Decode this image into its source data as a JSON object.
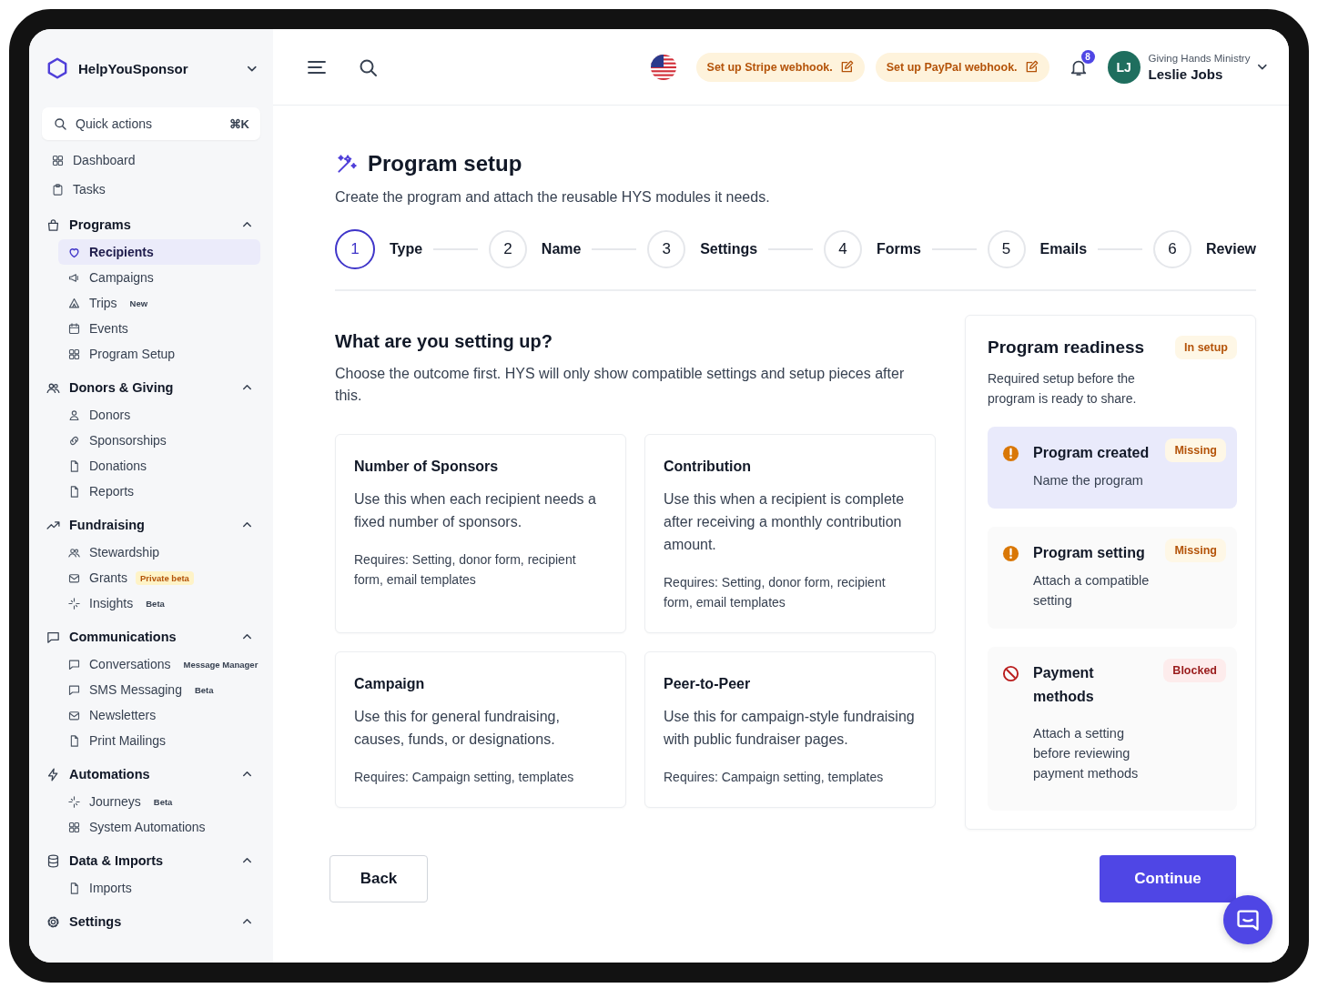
{
  "brand": {
    "name": "HelpYouSponsor"
  },
  "quick_actions": {
    "placeholder": "Quick actions",
    "shortcut": "⌘K"
  },
  "nav_top": [
    {
      "label": "Dashboard",
      "selected": false
    },
    {
      "label": "Tasks",
      "selected": false
    }
  ],
  "sections": [
    {
      "label": "Programs",
      "expanded": true,
      "items": [
        {
          "label": "Recipients",
          "selected": true
        },
        {
          "label": "Campaigns",
          "selected": false
        },
        {
          "label": "Trips",
          "selected": false,
          "badge": {
            "text": "New",
            "kind": "plain"
          }
        },
        {
          "label": "Events",
          "selected": false
        },
        {
          "label": "Program Setup",
          "selected": false
        }
      ]
    },
    {
      "label": "Donors & Giving",
      "expanded": true,
      "items": [
        {
          "label": "Donors",
          "selected": false
        },
        {
          "label": "Sponsorships",
          "selected": false
        },
        {
          "label": "Donations",
          "selected": false
        },
        {
          "label": "Reports",
          "selected": false
        }
      ]
    },
    {
      "label": "Fundraising",
      "expanded": true,
      "items": [
        {
          "label": "Stewardship",
          "selected": false
        },
        {
          "label": "Grants",
          "selected": false,
          "badge": {
            "text": "Private beta",
            "kind": "highlight"
          }
        },
        {
          "label": "Insights",
          "selected": false,
          "badge": {
            "text": "Beta",
            "kind": "plain"
          }
        }
      ]
    },
    {
      "label": "Communications",
      "expanded": true,
      "items": [
        {
          "label": "Conversations",
          "selected": false,
          "badge": {
            "text": "Message Manager",
            "kind": "plain"
          }
        },
        {
          "label": "SMS Messaging",
          "selected": false,
          "badge": {
            "text": "Beta",
            "kind": "plain"
          }
        },
        {
          "label": "Newsletters",
          "selected": false
        },
        {
          "label": "Print Mailings",
          "selected": false
        }
      ]
    },
    {
      "label": "Automations",
      "expanded": true,
      "items": [
        {
          "label": "Journeys",
          "selected": false,
          "badge": {
            "text": "Beta",
            "kind": "plain"
          }
        },
        {
          "label": "System Automations",
          "selected": false
        }
      ]
    },
    {
      "label": "Data & Imports",
      "expanded": true,
      "items": [
        {
          "label": "Imports",
          "selected": false
        }
      ]
    },
    {
      "label": "Settings",
      "expanded": true
    }
  ],
  "header": {
    "webhooks": [
      "Set up Stripe webhook.",
      "Set up PayPal webhook."
    ],
    "notifications": "8",
    "user": {
      "initials": "LJ",
      "organization": "Giving Hands Ministry",
      "name": "Leslie Jobs"
    }
  },
  "page": {
    "title": "Program setup",
    "subtitle": "Create the program and attach the reusable HYS modules it needs."
  },
  "steps": [
    {
      "number": "1",
      "label": "Type",
      "selected": true
    },
    {
      "number": "2",
      "label": "Name",
      "selected": false
    },
    {
      "number": "3",
      "label": "Settings",
      "selected": false
    },
    {
      "number": "4",
      "label": "Forms",
      "selected": false
    },
    {
      "number": "5",
      "label": "Emails",
      "selected": false
    },
    {
      "number": "6",
      "label": "Review",
      "selected": false
    }
  ],
  "question": {
    "heading": "What are you setting up?",
    "description": "Choose the outcome first. HYS will only show compatible settings and setup pieces after this."
  },
  "options": [
    {
      "title": "Number of Sponsors",
      "description": "Use this when each recipient needs a fixed number of sponsors.",
      "requires": "Requires: Setting, donor form, recipient form, email templates"
    },
    {
      "title": "Contribution",
      "description": "Use this when a recipient is complete after receiving a monthly contribution amount.",
      "requires": "Requires: Setting, donor form, recipient form, email templates"
    },
    {
      "title": "Campaign",
      "description": "Use this for general fundraising, causes, funds, or designations.",
      "requires": "Requires: Campaign setting, templates"
    },
    {
      "title": "Peer-to-Peer",
      "description": "Use this for campaign-style fundraising with public fundraiser pages.",
      "requires": "Requires: Campaign setting, templates"
    }
  ],
  "readiness": {
    "title": "Program readiness",
    "status": "In setup",
    "description": "Required setup before the program is ready to share.",
    "items": [
      {
        "title": "Program created",
        "detail": "Name the program",
        "status": "Missing",
        "kind": "missing",
        "selected": true
      },
      {
        "title": "Program setting",
        "detail": "Attach a compatible setting",
        "status": "Missing",
        "kind": "missing",
        "selected": false
      },
      {
        "title": "Payment methods",
        "detail": "Attach a setting before reviewing payment methods",
        "status": "Blocked",
        "kind": "blocked",
        "selected": false
      }
    ]
  },
  "actions": {
    "back": "Back",
    "continue": "Continue"
  }
}
